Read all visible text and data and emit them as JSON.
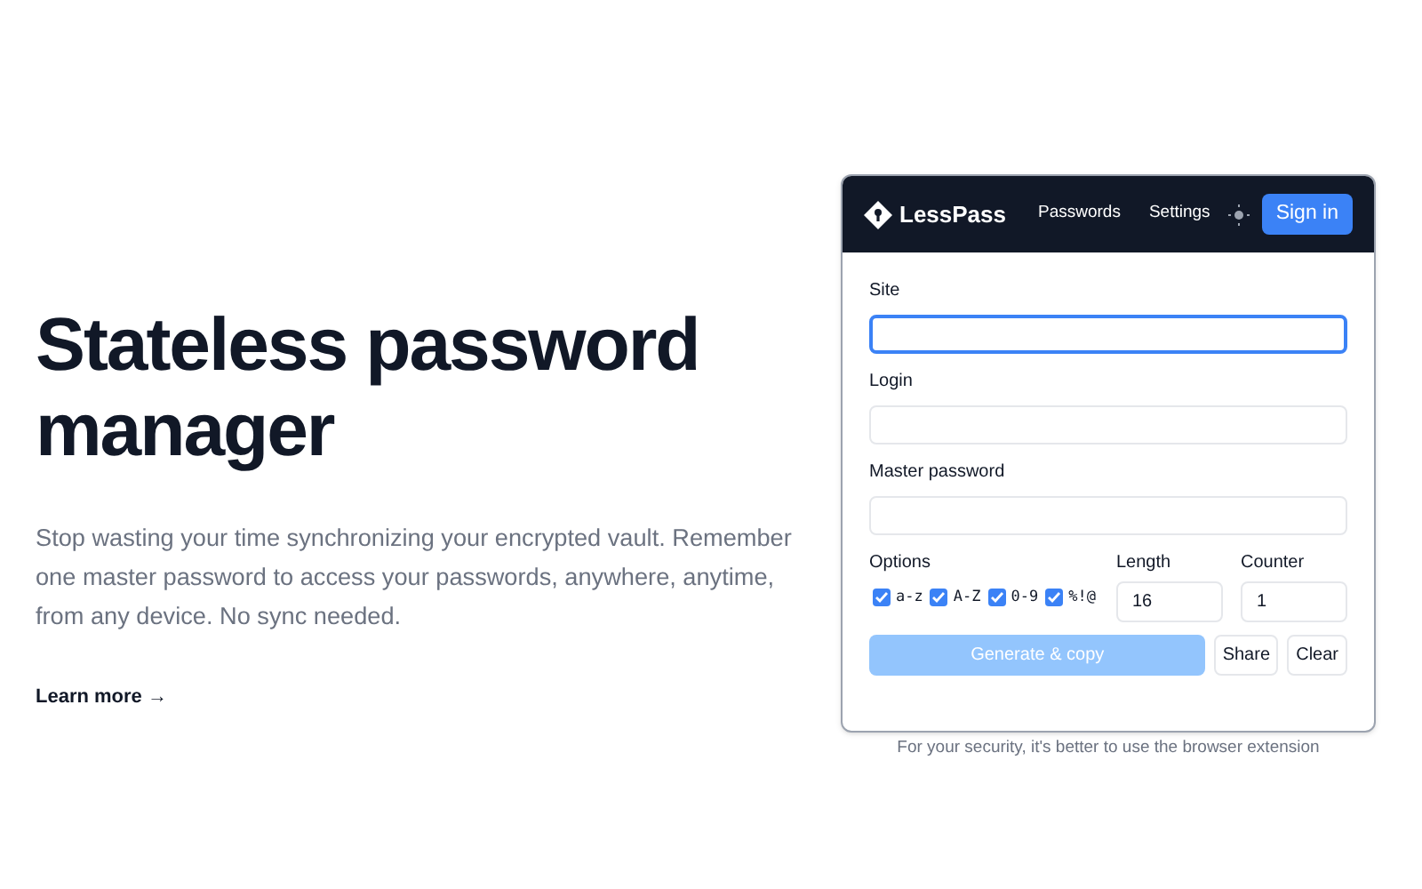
{
  "hero": {
    "title": "Stateless password manager",
    "description": "Stop wasting your time synchronizing your encrypted vault. Remember one master password to access your passwords, anywhere, anytime, from any device. No sync needed.",
    "link": "Learn more →"
  },
  "app": {
    "logo": "LessPass",
    "nav": [
      {
        "label": "Passwords"
      },
      {
        "label": "Settings"
      }
    ],
    "sign_in": "Sign in",
    "fields": [
      {
        "label": "Site",
        "focused": true
      },
      {
        "label": "Login",
        "focused": false
      },
      {
        "label": "Master password",
        "focused": false
      }
    ],
    "options_label": "Options",
    "options": [
      {
        "label": "a-z",
        "checked": true
      },
      {
        "label": "A-Z",
        "checked": true
      },
      {
        "label": "0-9",
        "checked": true
      },
      {
        "label": "%!@",
        "checked": true
      }
    ],
    "length": {
      "label": "Length",
      "value": "16"
    },
    "counter": {
      "label": "Counter",
      "value": "1"
    },
    "generate": {
      "label": "Generate & copy",
      "disabled": true
    },
    "share": "Share",
    "clear": "Clear"
  },
  "footer_note": "For your security, it's better to use the browser extension"
}
